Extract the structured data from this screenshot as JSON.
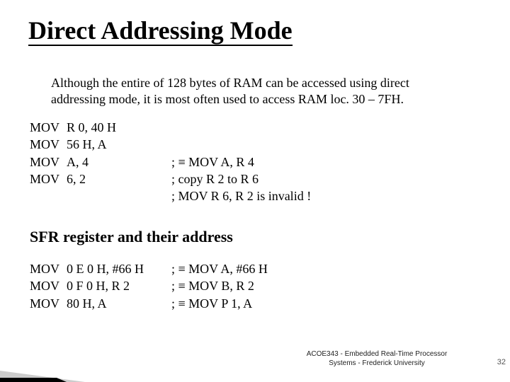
{
  "title": "Direct Addressing Mode",
  "intro": "Although the entire of 128 bytes of RAM can be accessed using direct addressing mode, it is most often used to access RAM loc. 30 – 7FH.",
  "block1": {
    "rows": [
      {
        "op": "MOV",
        "args": "R 0, 40 H",
        "cmt": ""
      },
      {
        "op": "MOV",
        "args": "56 H, A",
        "cmt": ""
      },
      {
        "op": "MOV",
        "args": "A, 4",
        "cmt": "; ≡ MOV A, R 4"
      },
      {
        "op": "MOV",
        "args": "6, 2",
        "cmt": "; copy R 2 to R 6"
      }
    ],
    "extra_cmt": "; MOV  R 6, R 2 is invalid !"
  },
  "subhead": "SFR register and their address",
  "block2": {
    "rows": [
      {
        "op": "MOV",
        "args": "0 E 0 H, #66 H",
        "cmt": "; ≡ MOV A, #66 H"
      },
      {
        "op": "MOV",
        "args": "0 F 0 H, R 2",
        "cmt": "; ≡ MOV B, R 2"
      },
      {
        "op": "MOV",
        "args": "80 H, A",
        "cmt": "; ≡ MOV P 1, A"
      }
    ]
  },
  "footer": "ACOE343 - Embedded Real-Time Processor Systems - Frederick University",
  "pagenum": "32"
}
